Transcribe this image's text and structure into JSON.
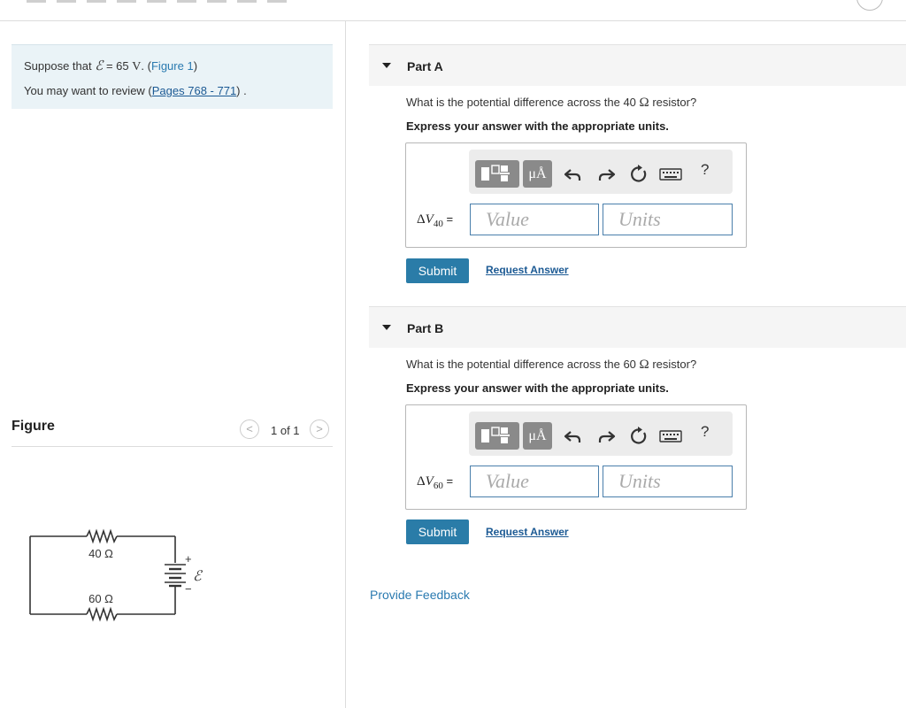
{
  "intro": {
    "prefix": "Suppose that",
    "emf_symbol": "ℰ",
    "eq": "= 65",
    "unit": "V",
    "period": ".",
    "fig_open": "(",
    "fig_link": "Figure 1",
    "fig_close": ")",
    "review_prefix": "You may want to review (",
    "review_link": "Pages 768 - 771",
    "review_suffix": ") ."
  },
  "figure": {
    "label": "Figure",
    "pager": "1 of 1",
    "prev": "<",
    "next": ">",
    "circuit": {
      "r1": "40 Ω",
      "r2": "60 Ω",
      "plus": "+",
      "minus": "−",
      "emf": "ℰ"
    }
  },
  "parts": [
    {
      "title": "Part A",
      "q_prefix": "What is the potential difference across the 40",
      "q_omega": "Ω",
      "q_suffix": "resistor?",
      "express": "Express your answer with the appropriate units.",
      "label_delta": "Δ",
      "label_v": "V",
      "label_sub": "40",
      "label_eq": "=",
      "value_placeholder": "Value",
      "units_placeholder": "Units",
      "units_btn": "μÅ",
      "help": "?",
      "submit": "Submit",
      "request": "Request Answer"
    },
    {
      "title": "Part B",
      "q_prefix": "What is the potential difference across the 60",
      "q_omega": "Ω",
      "q_suffix": "resistor?",
      "express": "Express your answer with the appropriate units.",
      "label_delta": "Δ",
      "label_v": "V",
      "label_sub": "60",
      "label_eq": "=",
      "value_placeholder": "Value",
      "units_placeholder": "Units",
      "units_btn": "μÅ",
      "help": "?",
      "submit": "Submit",
      "request": "Request Answer"
    }
  ],
  "feedback": "Provide Feedback"
}
